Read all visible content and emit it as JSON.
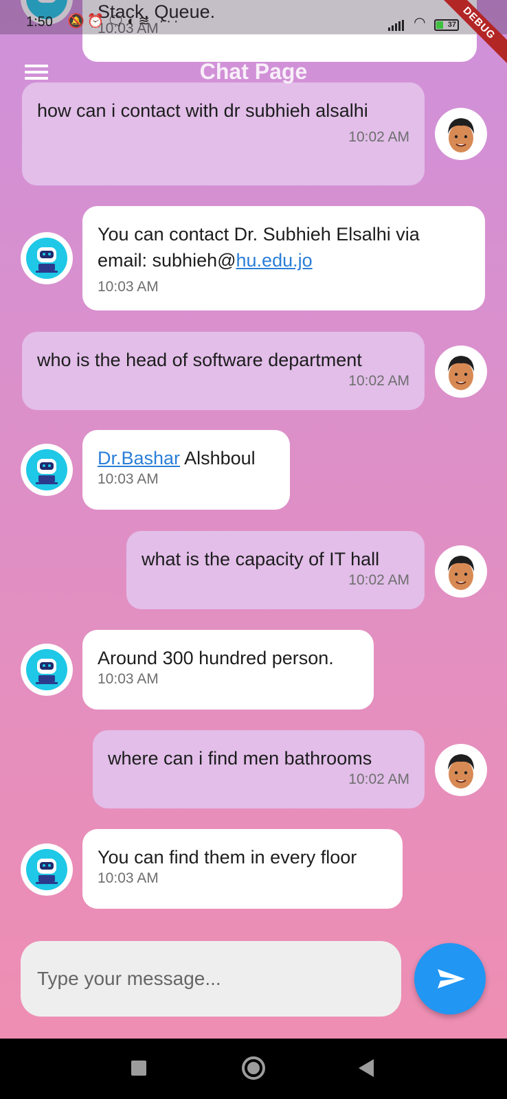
{
  "status_bar": {
    "time": "1:50",
    "battery": "37",
    "debug_banner": "DEBUG"
  },
  "app_bar": {
    "title": "Chat Page",
    "menu_icon": "hamburger-menu-icon"
  },
  "partial_message": {
    "text": "Stack, Queue.",
    "time": "10:03 AM"
  },
  "messages": [
    {
      "sender": "user",
      "text": "how can i contact with dr subhieh alsalhi",
      "time": "10:02 AM"
    },
    {
      "sender": "bot",
      "text_before": "You can contact Dr. Subhieh Elsalhi via email: subhieh@",
      "link": "hu.edu.jo",
      "text_after": "",
      "time": "10:03 AM"
    },
    {
      "sender": "user",
      "text": "who is the head of software department",
      "time": "10:02 AM"
    },
    {
      "sender": "bot",
      "text_before": "",
      "link": "Dr.Bashar",
      "text_after": " Alshboul",
      "time": "10:03 AM"
    },
    {
      "sender": "user",
      "text": "what is the capacity of IT hall",
      "time": "10:02 AM"
    },
    {
      "sender": "bot",
      "text": "Around 300 hundred person.",
      "time": "10:03 AM"
    },
    {
      "sender": "user",
      "text": "where can i find men bathrooms",
      "time": "10:02 AM"
    },
    {
      "sender": "bot",
      "text": "You can find them in every floor",
      "time": "10:03 AM"
    }
  ],
  "input": {
    "placeholder": "Type your message...",
    "value": ""
  },
  "colors": {
    "accent": "#2196f3",
    "user_bubble": "#e2bee9",
    "bot_bubble": "#ffffff"
  }
}
